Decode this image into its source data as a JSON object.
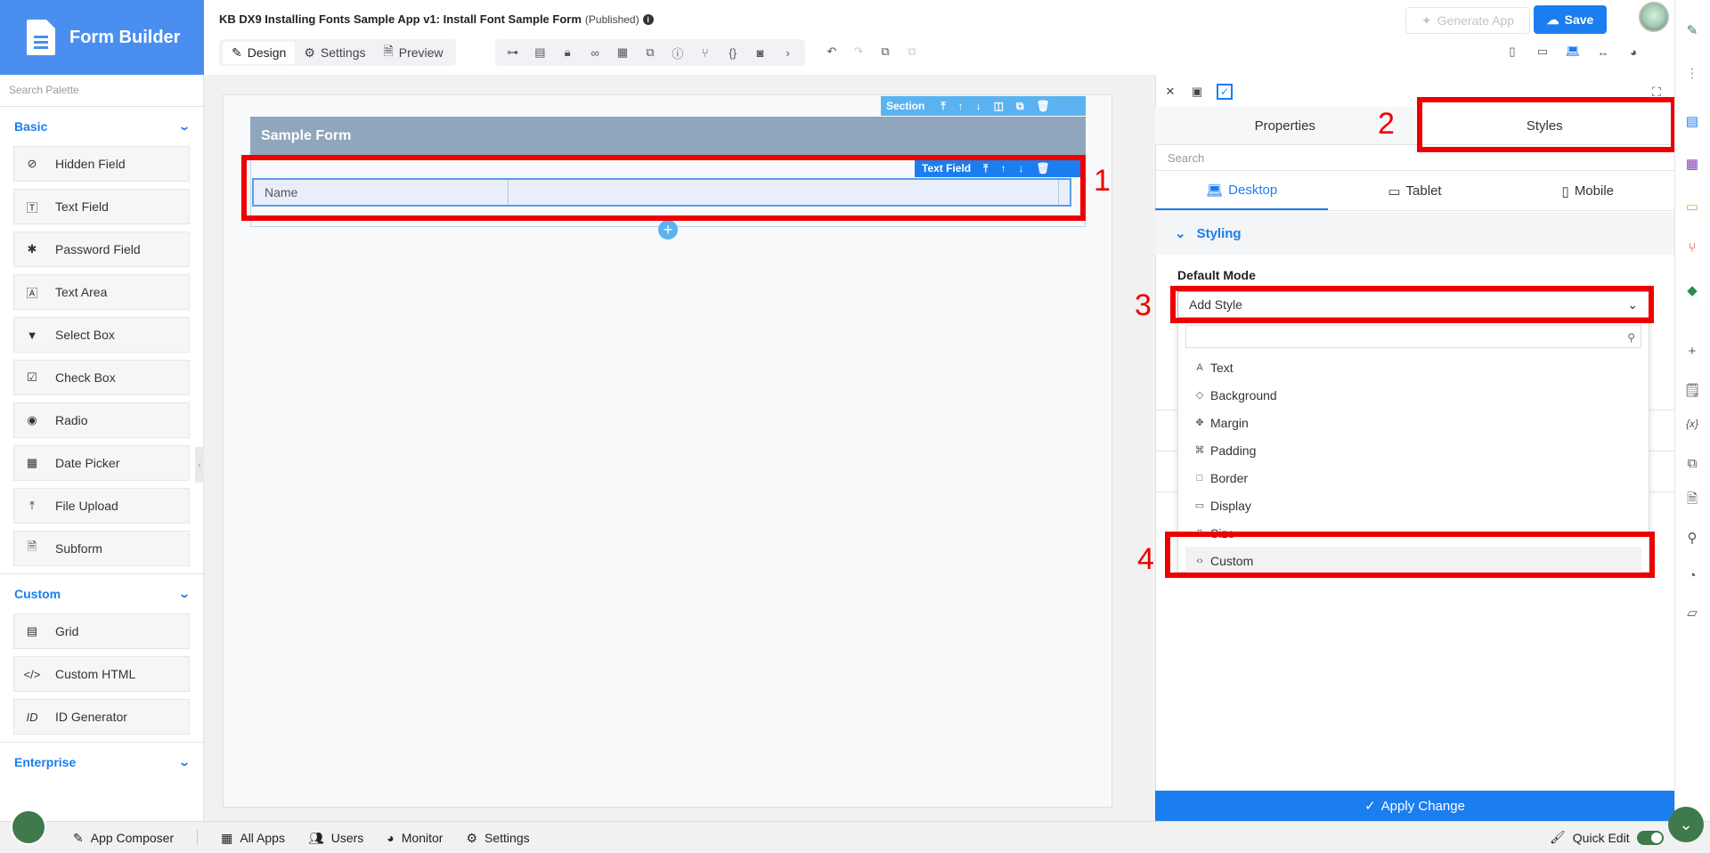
{
  "header": {
    "brand_title": "Form Builder",
    "app_title": "KB DX9 Installing Fonts Sample App v1: Install Font Sample Form",
    "status": "(Published)",
    "mode_tabs": [
      {
        "label": "Design",
        "icon": "design-icon",
        "active": true
      },
      {
        "label": "Settings",
        "icon": "gear-icon",
        "active": false
      },
      {
        "label": "Preview",
        "icon": "preview-icon",
        "active": false
      }
    ],
    "generate_label": "Generate App",
    "save_label": "Save",
    "toolbar_icons": [
      "tree-icon",
      "field-icon",
      "lock-icon",
      "glasses-icon",
      "grid-icon",
      "translate-icon",
      "help-icon",
      "branch-icon",
      "code-icon",
      "camera-icon"
    ]
  },
  "palette": {
    "search_placeholder": "Search Palette",
    "groups": [
      {
        "label": "Basic",
        "items": [
          {
            "label": "Hidden Field",
            "icon": "eye-slash-icon"
          },
          {
            "label": "Text Field",
            "icon": "text-field-icon"
          },
          {
            "label": "Password Field",
            "icon": "asterisk-icon"
          },
          {
            "label": "Text Area",
            "icon": "text-area-icon"
          },
          {
            "label": "Select Box",
            "icon": "select-icon"
          },
          {
            "label": "Check Box",
            "icon": "checkbox-icon"
          },
          {
            "label": "Radio",
            "icon": "radio-icon"
          },
          {
            "label": "Date Picker",
            "icon": "calendar-icon"
          },
          {
            "label": "File Upload",
            "icon": "upload-icon"
          },
          {
            "label": "Subform",
            "icon": "subform-icon"
          }
        ]
      },
      {
        "label": "Custom",
        "items": [
          {
            "label": "Grid",
            "icon": "table-icon"
          },
          {
            "label": "Custom HTML",
            "icon": "code-icon"
          },
          {
            "label": "ID Generator",
            "icon": "id-icon"
          }
        ]
      },
      {
        "label": "Enterprise",
        "items": []
      }
    ]
  },
  "canvas": {
    "section_label": "Section",
    "form_title": "Sample Form",
    "text_field_label": "Text Field",
    "field_label": "Name"
  },
  "annotations": [
    "1",
    "2",
    "3",
    "4"
  ],
  "properties_panel": {
    "tabs": [
      {
        "label": "Properties",
        "active": false
      },
      {
        "label": "Styles",
        "active": true
      }
    ],
    "search_placeholder": "Search",
    "device_tabs": [
      {
        "label": "Desktop",
        "active": true
      },
      {
        "label": "Tablet",
        "active": false
      },
      {
        "label": "Mobile",
        "active": false
      }
    ],
    "section_title": "Styling",
    "default_mode_label": "Default Mode",
    "select_value": "Add Style",
    "options": [
      {
        "label": "Text",
        "icon": "text-icon"
      },
      {
        "label": "Background",
        "icon": "fill-icon"
      },
      {
        "label": "Margin",
        "icon": "move-icon"
      },
      {
        "label": "Padding",
        "icon": "padding-icon"
      },
      {
        "label": "Border",
        "icon": "border-icon"
      },
      {
        "label": "Display",
        "icon": "display-icon"
      },
      {
        "label": "Size",
        "icon": "size-icon"
      },
      {
        "label": "Custom",
        "icon": "code-icon"
      }
    ],
    "apply_label": "Apply Change"
  },
  "bottom_bar": {
    "items": [
      {
        "label": "App Composer",
        "icon": "edit-icon"
      },
      {
        "label": "All Apps",
        "icon": "apps-icon"
      },
      {
        "label": "Users",
        "icon": "users-icon"
      },
      {
        "label": "Monitor",
        "icon": "monitor-icon"
      },
      {
        "label": "Settings",
        "icon": "gears-icon"
      }
    ],
    "quick_edit_label": "Quick Edit"
  }
}
